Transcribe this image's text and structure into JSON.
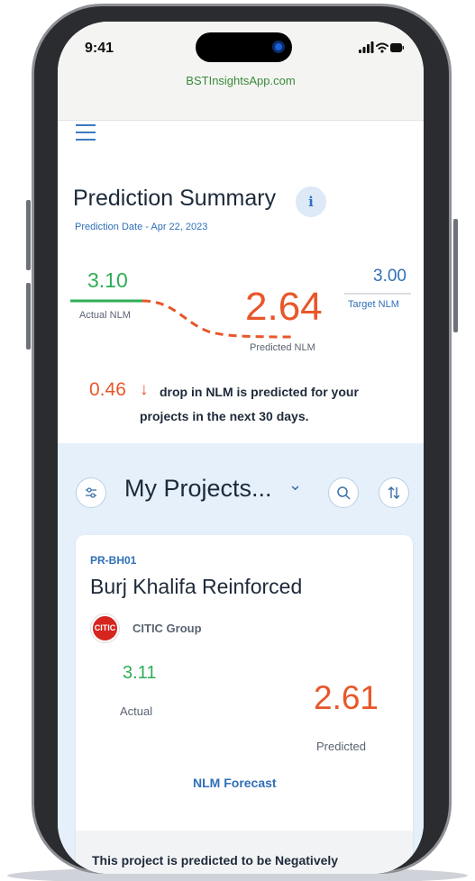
{
  "status_bar": {
    "time": "9:41",
    "url": "BSTInsightsApp.com"
  },
  "summary": {
    "title": "Prediction Summary",
    "date_label": "Prediction Date - Apr 22, 2023",
    "actual_value": "3.10",
    "actual_label": "Actual NLM",
    "predicted_value": "2.64",
    "predicted_label": "Predicted NLM",
    "target_value": "3.00",
    "target_label": "Target NLM",
    "drop_value": "0.46",
    "drop_arrow": "↓",
    "drop_text_1": "drop in NLM is predicted for your",
    "drop_text_2": "projects in the next 30 days."
  },
  "projects": {
    "dropdown_label": "My Projects...",
    "dropdown_caret": "⌄"
  },
  "card": {
    "code": "PR-BH01",
    "name": "Burj Khalifa Reinforced",
    "company": "CITIC Group",
    "company_logo_text": "CITIC",
    "actual_value": "3.11",
    "actual_label": "Actual",
    "predicted_value": "2.61",
    "predicted_label": "Predicted",
    "forecast_label": "NLM Forecast",
    "footer_line1": "This project is predicted to be Negatively"
  },
  "colors": {
    "green": "#2fae57",
    "orange": "#e8572a",
    "blue": "#2f6fb8",
    "dark": "#1e2a3a"
  },
  "icons": [
    "menu-icon",
    "info-icon",
    "filter-icon",
    "search-icon",
    "sort-icon",
    "chevron-down-icon",
    "trend-down-icon"
  ]
}
